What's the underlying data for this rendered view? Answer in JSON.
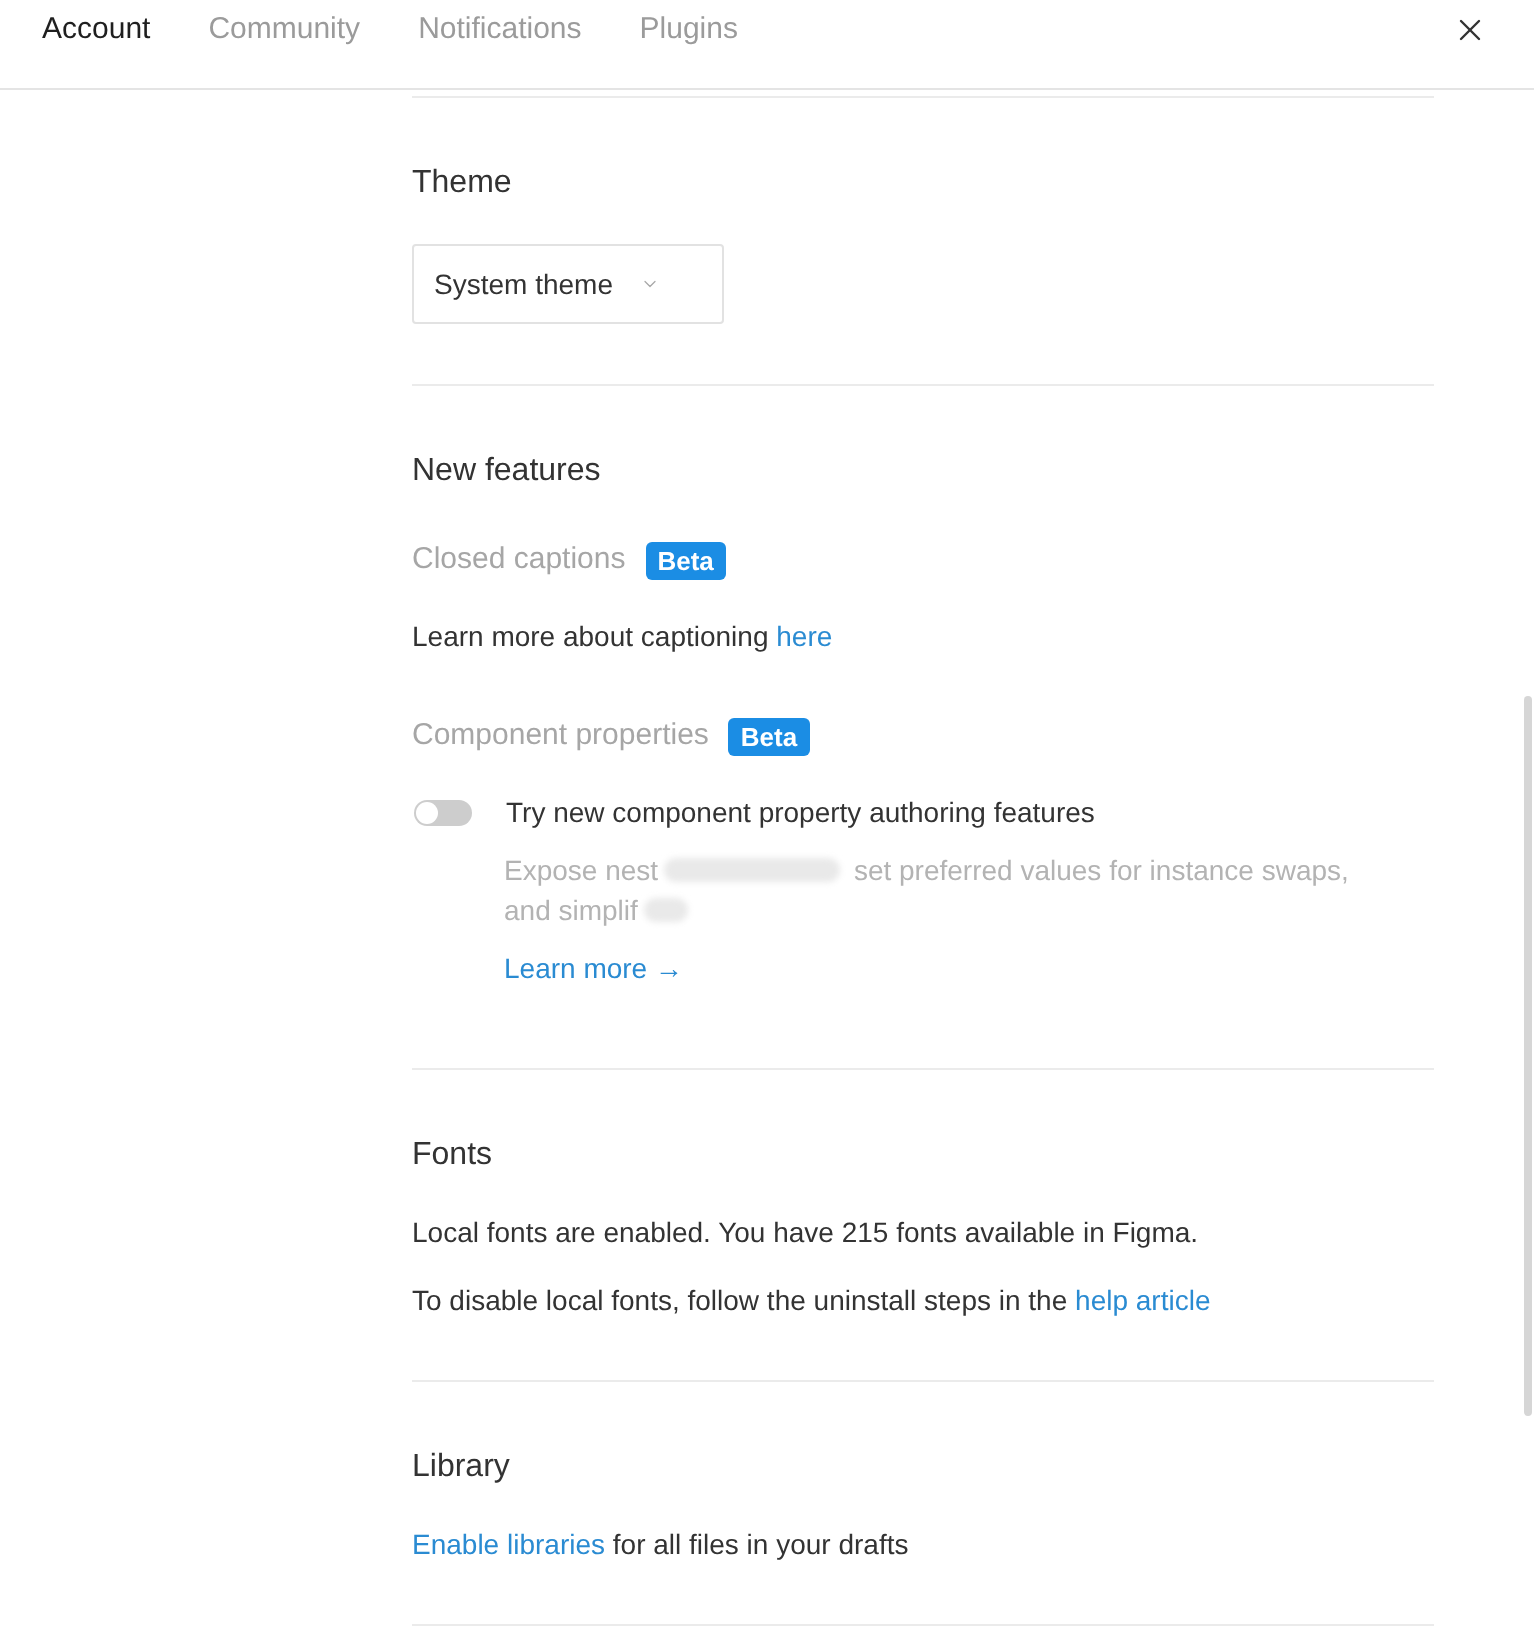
{
  "tabs": [
    {
      "label": "Account",
      "selected": true
    },
    {
      "label": "Community",
      "selected": false
    },
    {
      "label": "Notifications",
      "selected": false
    },
    {
      "label": "Plugins",
      "selected": false
    }
  ],
  "sections": [
    {
      "kind": "theme",
      "title": "Theme",
      "dropdown": {
        "value": "System theme"
      }
    },
    {
      "kind": "features",
      "title": "New features",
      "features": [
        {
          "name": "Closed captions",
          "badge": "Beta",
          "parts": [
            {
              "kind": "text",
              "text": "Learn more about captioning"
            },
            {
              "kind": "link",
              "text": "here"
            }
          ]
        },
        {
          "name": "Component properties",
          "badge": "Beta",
          "toggle": {
            "label": "Try new component property authoring features",
            "on": false,
            "description_parts": [
              "Expose nest",
              "set preferred values for instance swaps, and simplif"
            ],
            "link": "Learn more →"
          }
        }
      ]
    },
    {
      "kind": "text",
      "title": "Fonts",
      "lines": [
        [
          {
            "kind": "text",
            "text": "Local fonts are enabled. You have 215 fonts available in Figma."
          }
        ],
        [
          {
            "kind": "text",
            "text": "To disable local fonts, follow the uninstall steps in the"
          },
          {
            "kind": "link",
            "text": "help article"
          }
        ]
      ]
    },
    {
      "kind": "text",
      "title": "Library",
      "lines": [
        [
          {
            "kind": "link",
            "text": "Enable libraries"
          },
          {
            "kind": "text",
            "text": "for all files in your drafts"
          }
        ]
      ]
    }
  ]
}
